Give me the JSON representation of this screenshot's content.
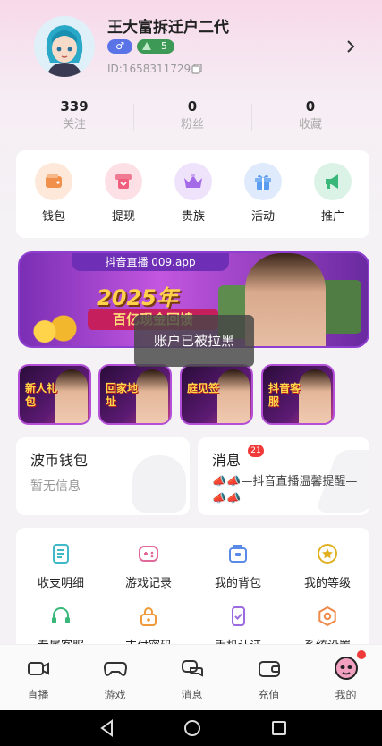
{
  "profile": {
    "username": "王大富拆迁户二代",
    "gender_symbol": "♂",
    "level": "5",
    "user_id": "ID:1658311729"
  },
  "stats": [
    {
      "count": "339",
      "label": "关注"
    },
    {
      "count": "0",
      "label": "粉丝"
    },
    {
      "count": "0",
      "label": "收藏"
    }
  ],
  "quick_actions": [
    {
      "label": "钱包",
      "icon": "wallet-icon",
      "color": "#f0904a"
    },
    {
      "label": "提现",
      "icon": "withdraw-icon",
      "color": "#f0607e"
    },
    {
      "label": "贵族",
      "icon": "crown-icon",
      "color": "#a46ae8"
    },
    {
      "label": "活动",
      "icon": "gift-icon",
      "color": "#5a9cf0"
    },
    {
      "label": "推广",
      "icon": "megaphone-icon",
      "color": "#3ab87a"
    }
  ],
  "banner": {
    "tag": "抖音直播 009.app",
    "year": "2025年",
    "subtitle": "百亿现金回馈"
  },
  "toast": "账户已被拉黑",
  "promos": [
    {
      "label": "新人礼包"
    },
    {
      "label": "回家地址"
    },
    {
      "label": "庭见签"
    },
    {
      "label": "抖音客服"
    }
  ],
  "wallet": {
    "title": "波币钱包",
    "status": "暂无信息"
  },
  "messages": {
    "title": "消息",
    "badge": "21",
    "preview": "📣📣—抖音直播温馨提醒—📣📣"
  },
  "menu": [
    {
      "label": "收支明细",
      "icon": "ledger-icon",
      "color": "#3fb8c8"
    },
    {
      "label": "游戏记录",
      "icon": "gamepad-icon",
      "color": "#e06a9a"
    },
    {
      "label": "我的背包",
      "icon": "backpack-icon",
      "color": "#5a8ae8"
    },
    {
      "label": "我的等级",
      "icon": "star-badge-icon",
      "color": "#e0b020"
    },
    {
      "label": "专属客服",
      "icon": "headset-icon",
      "color": "#3ab87a"
    },
    {
      "label": "支付密码",
      "icon": "lock-icon",
      "color": "#f09a3a"
    },
    {
      "label": "手机认证",
      "icon": "phone-check-icon",
      "color": "#9a6ae0"
    },
    {
      "label": "系统设置",
      "icon": "settings-icon",
      "color": "#f08a4a"
    }
  ],
  "tabs": [
    {
      "label": "直播",
      "icon": "live-camera-icon"
    },
    {
      "label": "游戏",
      "icon": "gamepad-icon"
    },
    {
      "label": "消息",
      "icon": "chat-icon"
    },
    {
      "label": "充值",
      "icon": "wallet-icon"
    },
    {
      "label": "我的",
      "icon": "profile-face-icon"
    }
  ]
}
